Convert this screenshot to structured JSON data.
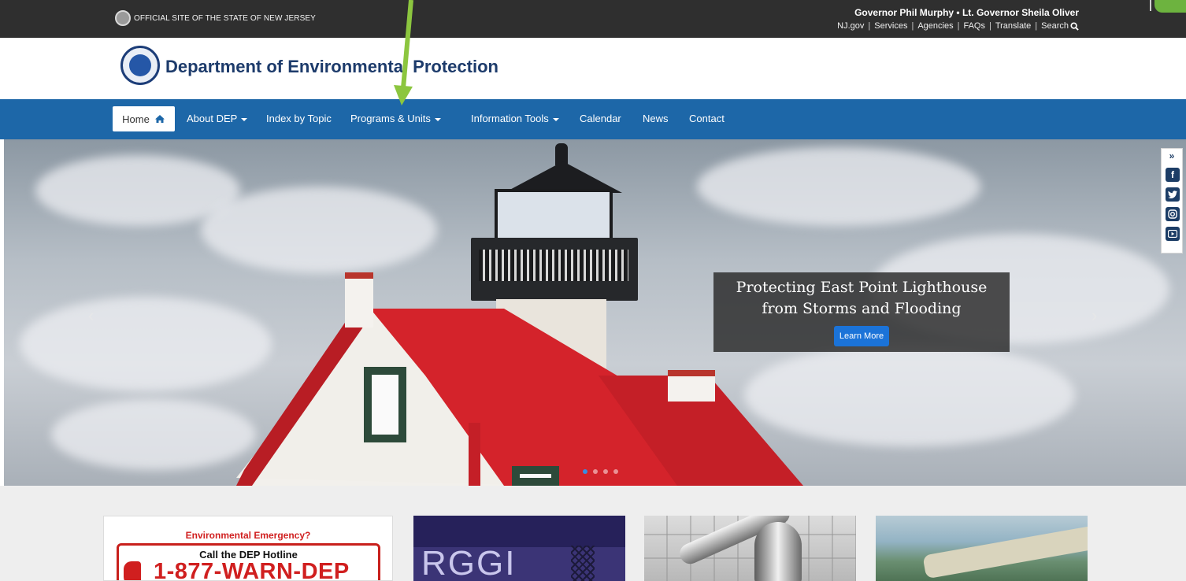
{
  "topbar": {
    "official_text": "OFFICIAL SITE OF THE STATE OF NEW JERSEY",
    "governor_text": "Governor Phil Murphy • Lt. Governor Sheila Oliver",
    "links": [
      "NJ.gov",
      "Services",
      "Agencies",
      "FAQs",
      "Translate"
    ],
    "search_label": "Search"
  },
  "header": {
    "title": "Department of Environmental Protection"
  },
  "nav": {
    "home_label": "Home",
    "items": [
      "About DEP",
      "Index by Topic",
      "Programs & Units",
      "Information Tools",
      "Calendar",
      "News",
      "Contact"
    ]
  },
  "hero": {
    "caption_line1": "Protecting East Point Lighthouse",
    "caption_line2": "from Storms and Flooding",
    "button_label": "Learn More",
    "slide_count": 4,
    "active_slide": 1
  },
  "social": {
    "collapse_label": "»",
    "icons": [
      "facebook-icon",
      "twitter-icon",
      "instagram-icon",
      "youtube-icon"
    ]
  },
  "cards": {
    "emergency_heading": "Environmental Emergency?",
    "hotline_label": "Call the DEP Hotline",
    "hotline_number": "1-877-WARN-DEP",
    "rggi_text": "RGGI"
  },
  "colors": {
    "nav_blue": "#1d67a8",
    "topbar": "#2f2f2f",
    "annotation_green": "#8cc63f",
    "emergency_red": "#d01f1f"
  }
}
